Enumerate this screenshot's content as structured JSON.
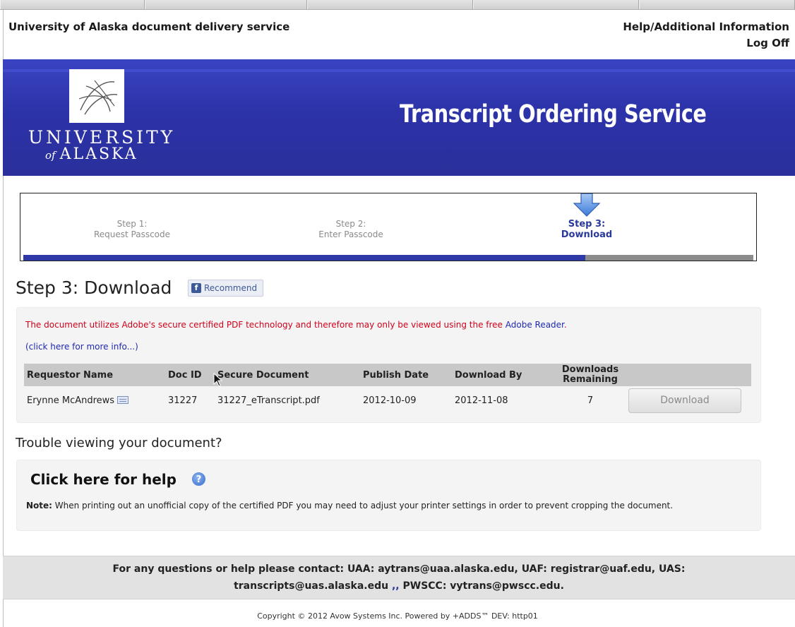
{
  "header": {
    "site_title": "University of Alaska document delivery service",
    "help_link": "Help/Additional Information",
    "logoff_link": "Log Off"
  },
  "banner": {
    "logo_line1": "UNIVERSITY",
    "logo_of": "of",
    "logo_line2": "ALASKA",
    "title": "Transcript Ordering Service",
    "color": "#2c33a8"
  },
  "stepper": {
    "steps": [
      {
        "line1": "Step 1:",
        "line2": "Request Passcode",
        "active": false
      },
      {
        "line1": "Step 2:",
        "line2": "Enter Passcode",
        "active": false
      },
      {
        "line1": "Step 3:",
        "line2": "Download",
        "active": true
      }
    ],
    "progress_fraction": 0.77
  },
  "main": {
    "heading": "Step 3: Download",
    "recommend_label": "Recommend",
    "notice_text": "The document utilizes Adobe's secure certified PDF technology and therefore may only be viewed using the free ",
    "adobe_link": "Adobe Reader",
    "notice_end": ".",
    "more_info_link": "(click here for more info...)"
  },
  "table": {
    "headers": {
      "requestor": "Requestor Name",
      "doc_id": "Doc ID",
      "secure_doc": "Secure Document",
      "publish_date": "Publish Date",
      "download_by": "Download By",
      "remaining_line1": "Downloads",
      "remaining_line2": "Remaining"
    },
    "row": {
      "requestor": "Erynne McAndrews",
      "doc_id": "31227",
      "secure_doc": "31227_eTranscript.pdf",
      "publish_date": "2012-10-09",
      "download_by": "2012-11-08",
      "remaining": "7",
      "download_label": "Download"
    }
  },
  "trouble": {
    "heading": "Trouble viewing your document?",
    "help_heading": "Click here for help",
    "help_icon": "?",
    "note_label": "Note:",
    "note_text": " When printing out an unofficial copy of the certified PDF you may need to adjust your printer settings in order to prevent cropping the document."
  },
  "footer": {
    "contact_line1": "For any questions or help please contact: UAA: aytrans@uaa.alaska.edu, UAF: registrar@uaf.edu, UAS:",
    "contact_line2_a": "transcripts@uas.alaska.edu ",
    "contact_line2_sep": ",,",
    "contact_line2_b": " PWSCC: vytrans@pwscc.edu.",
    "copyright": "Copyright © 2012 Avow Systems Inc. Powered by +ADDS™ DEV: http01"
  },
  "colors": {
    "accent_blue": "#2e38a6",
    "notice_red": "#d0021b",
    "link_blue": "#1f2ab0"
  }
}
